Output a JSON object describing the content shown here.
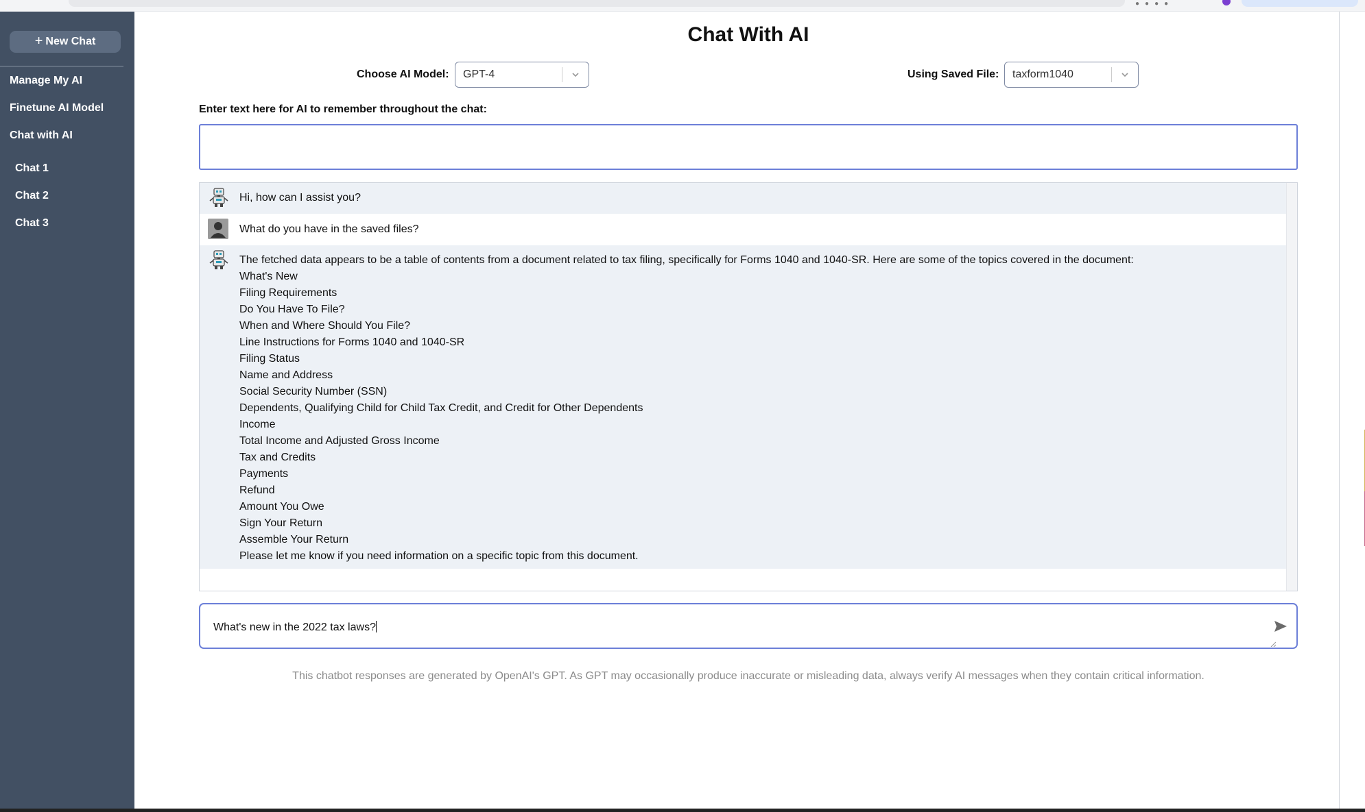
{
  "sidebar": {
    "new_chat_label": "New Chat",
    "links": [
      "Manage My AI",
      "Finetune AI Model",
      "Chat with AI"
    ],
    "chats": [
      "Chat 1",
      "Chat 2",
      "Chat 3"
    ]
  },
  "header": {
    "title": "Chat With AI"
  },
  "controls": {
    "model_label": "Choose AI Model:",
    "model_value": "GPT-4",
    "file_label": "Using Saved File:",
    "file_value": "taxform1040"
  },
  "memory": {
    "label": "Enter text here for AI to remember throughout the chat:",
    "value": ""
  },
  "messages": [
    {
      "role": "bot",
      "text": "Hi, how can I assist you?"
    },
    {
      "role": "user",
      "text": "What do you have in the saved files?"
    },
    {
      "role": "bot",
      "lines": [
        "The fetched data appears to be a table of contents from a document related to tax filing, specifically for Forms 1040 and 1040-SR. Here are some of the topics covered in the document:",
        "What's New",
        "Filing Requirements",
        "Do You Have To File?",
        "When and Where Should You File?",
        "Line Instructions for Forms 1040 and 1040-SR",
        "Filing Status",
        "Name and Address",
        "Social Security Number (SSN)",
        "Dependents, Qualifying Child for Child Tax Credit, and Credit for Other Dependents",
        "Income",
        "Total Income and Adjusted Gross Income",
        "Tax and Credits",
        "Payments",
        "Refund",
        "Amount You Owe",
        "Sign Your Return",
        "Assemble Your Return",
        "Please let me know if you need information on a specific topic from this document."
      ]
    }
  ],
  "input": {
    "value": "What's new in the 2022 tax laws?"
  },
  "disclaimer": "This chatbot responses are generated by OpenAI's GPT. As GPT may occasionally produce inaccurate or misleading data, always verify AI messages when they contain critical information.",
  "icons": {
    "bot": "robot-icon",
    "user": "user-avatar-icon",
    "send": "send-icon",
    "chevron": "chevron-down-icon",
    "plus": "plus-icon"
  }
}
